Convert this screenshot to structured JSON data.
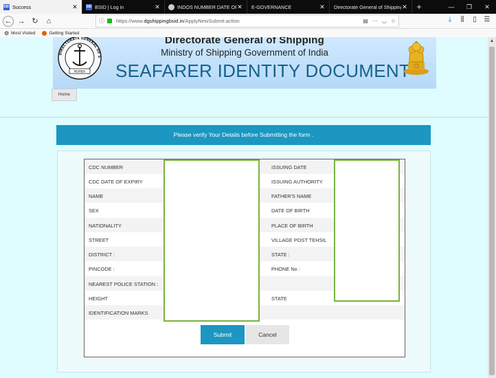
{
  "browser": {
    "tabs": [
      {
        "title": "Success",
        "favicon": "sid",
        "favicon_color": "#3a5fd0",
        "active": true
      },
      {
        "title": "BSID | Log in",
        "favicon": "sid",
        "favicon_color": "#3a5fd0",
        "active": false
      },
      {
        "title": "INDOS NUMBER DATE OF ISS",
        "favicon": "chrome-like",
        "favicon_color": "#cccccc",
        "active": false
      },
      {
        "title": "E-GOVERNANCE",
        "favicon": "",
        "favicon_color": "",
        "active": false
      },
      {
        "title": "Directorate General of Shipping",
        "favicon": "",
        "favicon_color": "",
        "active": false
      }
    ],
    "url_prefix": "https://www.",
    "url_domain": "dgshippingbsid.in",
    "url_path": "/ApplyNewSubmit.action",
    "bookmarks": [
      {
        "label": "Most Visited",
        "icon": "gear-icon"
      },
      {
        "label": "Getting Started",
        "icon": "firefox-icon"
      }
    ],
    "toolbar_icons": [
      "download-icon",
      "library-icon",
      "sidebar-icon",
      "menu-icon"
    ]
  },
  "banner": {
    "line1": "Directorate General of Shipping",
    "line2": "Ministry of Shipping Government of India",
    "line3": "SEAFARER IDENTITY DOCUMENT",
    "emblem_caption": "MUMBAI",
    "emblem_text": "DIRECTORATE GENERAL OF SHIPPING"
  },
  "nav": {
    "home": "Home"
  },
  "verify_message": "Please verify Your Details before Submitting the form .",
  "form": {
    "left_labels": [
      "CDC NUMBER",
      "CDC DATE OF EXPIRY",
      "NAME",
      "SEX",
      "NATIONALITY",
      "STREET",
      "DISTRICT :",
      "PINCODE :",
      "NEAREST POLICE STATION :",
      "HEIGHT",
      "IDENTIFICATION MARKS"
    ],
    "right_labels": [
      "ISSUING DATE",
      "ISSUING AUTHORITY",
      "FATHER'S NAME",
      "DATE OF BIRTH",
      "PLACE OF BIRTH",
      "VILLAGE POST TEHSIL",
      "STATE :",
      "PHONE No :",
      "",
      "STATE",
      ""
    ],
    "submit_label": "Submit",
    "cancel_label": "Cancel"
  },
  "colors": {
    "accent": "#1b97c2",
    "redaction_border": "#78b33f",
    "page_bg": "#dffcff"
  }
}
